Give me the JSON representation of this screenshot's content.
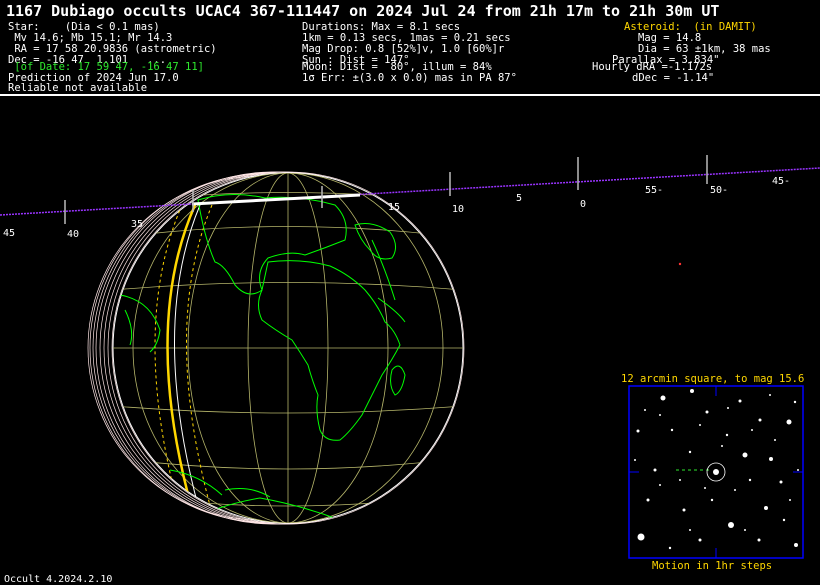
{
  "title": "1167 Dubiago occults UCAC4 367-111447 on 2024 Jul 24 from 21h 17m to 21h 30m UT",
  "star": {
    "line1": "Star:    (Dia < 0.1 mas)",
    "line2": " Mv 14.6; Mb 15.1; Mr 14.3",
    "line3": " RA = 17 58 20.9836 (astrometric)",
    "line4": "Dec = -16 47  1.101   ...",
    "line5": " [of Date: 17 59 47, -16 47 11]",
    "line6": "Prediction of 2024 Jun 17.0",
    "line7": "Reliable not available"
  },
  "event": {
    "line1": "Durations: Max = 8.1 secs",
    "line2": "1km = 0.13 secs, 1mas = 0.21 secs",
    "line3": "Mag Drop: 0.8 [52%]v, 1.0 [60%]r",
    "line4": "Sun : Dist = 147°",
    "line5": "Moon: Dist =  80°, illum = 84%",
    "line6": "1σ Err: ±(3.0 x 0.0) mas in PA 87°"
  },
  "asteroid": {
    "header": "Asteroid:  (in DAMIT)",
    "line1": "Mag = 14.8",
    "line2": "Dia = 63 ±1km, 38 mas",
    "line3": "Parallax = 3.834\"",
    "line4": "Hourly dRA =-1.172s",
    "line5": "dDec = -1.14\""
  },
  "path_scale": {
    "labels": [
      "45",
      "40",
      "35",
      "15",
      "10",
      "5",
      "0",
      "55-",
      "50-",
      "45-"
    ]
  },
  "starchart": {
    "title": "12 arcmin square, to mag 15.6",
    "footer": "Motion in 1hr steps"
  },
  "footer": "Occult 4.2024.2.10",
  "colors": {
    "background": "#000000",
    "text": "#ffffff",
    "highlight_green": "#2ee82e",
    "highlight_yellow": "#ffd700",
    "path_line": "#9933ff",
    "chart_border": "#0000ff",
    "grid": "#b5b56a",
    "coastline": "#00ff00"
  }
}
